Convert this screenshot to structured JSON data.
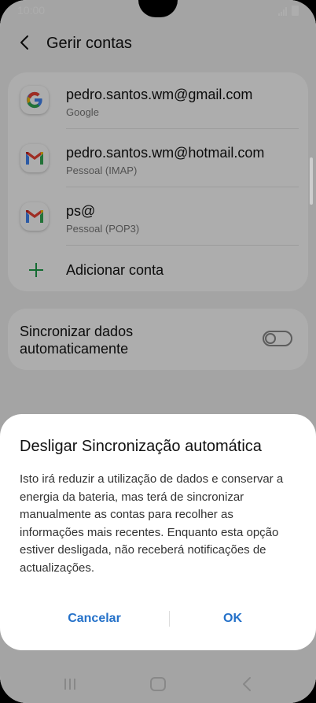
{
  "status_bar": {
    "time": "10:00"
  },
  "header": {
    "title": "Gerir contas"
  },
  "accounts": [
    {
      "email": "pedro.santos.wm@gmail.com",
      "type": "Google",
      "icon": "google-icon"
    },
    {
      "email": "pedro.santos.wm@hotmail.com",
      "type": "Pessoal (IMAP)",
      "icon": "gmail-icon"
    },
    {
      "email": "ps@",
      "type": "Pessoal (POP3)",
      "icon": "gmail-icon"
    }
  ],
  "add_account": {
    "label": "Adicionar conta"
  },
  "sync": {
    "label": "Sincronizar dados automaticamente",
    "enabled": false
  },
  "dialog": {
    "title": "Desligar Sincronização automática",
    "body": "Isto irá reduzir a utilização de dados e conservar a energia da bateria, mas terá de sincronizar manualmente as contas para recolher as informações mais recentes. Enquanto esta opção estiver desligada, não receberá notificações de actualizações.",
    "cancel_label": "Cancelar",
    "ok_label": "OK"
  },
  "colors": {
    "accent": "#2471c9",
    "google_blue": "#4285F4",
    "google_red": "#EA4335",
    "google_yellow": "#FBBC05",
    "google_green": "#34A853",
    "plus_green": "#1e9e4a"
  }
}
